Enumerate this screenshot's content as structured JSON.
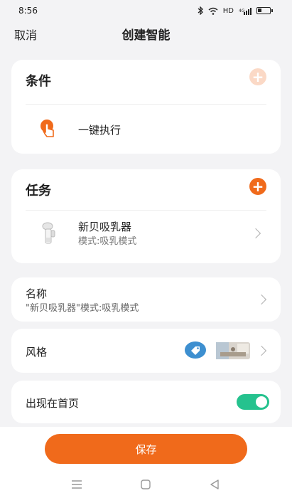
{
  "status_bar": {
    "time": "8:56",
    "network": "HD",
    "signal": "4G"
  },
  "nav": {
    "cancel_label": "取消",
    "title": "创建智能"
  },
  "conditions": {
    "title": "条件",
    "item": {
      "label": "一键执行",
      "icon": "tap-hand-icon"
    }
  },
  "tasks": {
    "title": "任务",
    "item": {
      "name": "新贝吸乳器",
      "mode": "模式:吸乳模式",
      "icon": "breast-pump-icon"
    }
  },
  "name_row": {
    "label": "名称",
    "value": "\"新贝吸乳器\"模式:吸乳模式"
  },
  "style_row": {
    "label": "风格"
  },
  "homepage_row": {
    "label": "出现在首页",
    "enabled": true
  },
  "save_label": "保存",
  "colors": {
    "accent": "#f06a1b",
    "toggle_on": "#25c28e",
    "tag_blue": "#3d8fd0",
    "disabled_add": "#fbd9c6"
  }
}
